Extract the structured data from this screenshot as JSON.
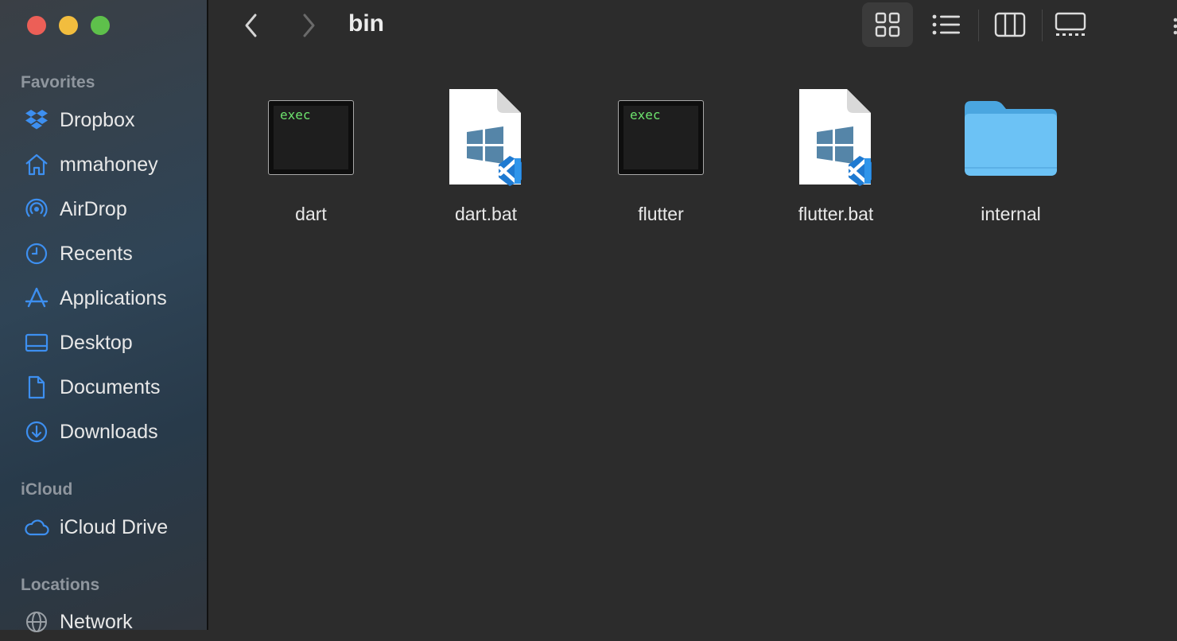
{
  "window": {
    "title": "bin"
  },
  "sidebar": {
    "sections": [
      {
        "label": "Favorites",
        "items": [
          {
            "label": "Dropbox",
            "icon": "dropbox-icon"
          },
          {
            "label": "mmahoney",
            "icon": "home-icon"
          },
          {
            "label": "AirDrop",
            "icon": "airdrop-icon"
          },
          {
            "label": "Recents",
            "icon": "clock-icon"
          },
          {
            "label": "Applications",
            "icon": "applications-icon"
          },
          {
            "label": "Desktop",
            "icon": "desktop-icon"
          },
          {
            "label": "Documents",
            "icon": "document-icon"
          },
          {
            "label": "Downloads",
            "icon": "download-icon"
          }
        ]
      },
      {
        "label": "iCloud",
        "items": [
          {
            "label": "iCloud Drive",
            "icon": "cloud-icon"
          }
        ]
      },
      {
        "label": "Locations",
        "items": [
          {
            "label": "Network",
            "icon": "globe-icon"
          }
        ]
      }
    ]
  },
  "toolbar": {
    "back": "chevron-left-icon",
    "forward": "chevron-right-icon",
    "views": [
      "icon-view",
      "list-view",
      "column-view",
      "gallery-view"
    ],
    "active_view": "icon-view"
  },
  "files": [
    {
      "name": "dart",
      "kind": "exec",
      "badge": "exec"
    },
    {
      "name": "dart.bat",
      "kind": "bat"
    },
    {
      "name": "flutter",
      "kind": "exec",
      "badge": "exec"
    },
    {
      "name": "flutter.bat",
      "kind": "bat"
    },
    {
      "name": "internal",
      "kind": "folder"
    }
  ],
  "colors": {
    "accent": "#3d8ff0",
    "exec_text": "#6ee46e",
    "folder": "#6cc2f5"
  }
}
